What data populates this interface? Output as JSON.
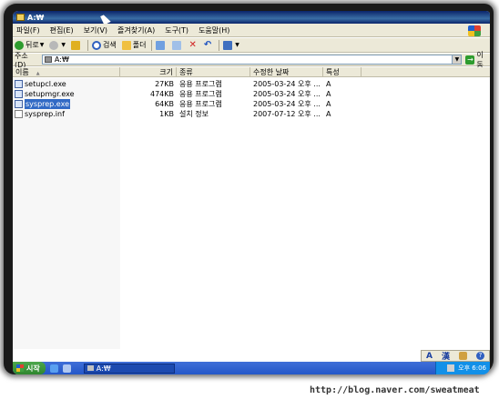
{
  "window": {
    "title": "A:₩"
  },
  "menu": {
    "items": [
      "파일(F)",
      "편집(E)",
      "보기(V)",
      "즐겨찾기(A)",
      "도구(T)",
      "도움말(H)"
    ]
  },
  "toolbar": {
    "back_label": "뒤로",
    "search_label": "검색",
    "folders_label": "폴더"
  },
  "address": {
    "label": "주소(D)",
    "value": "A:₩",
    "go_label": "이동"
  },
  "columns": {
    "name": "이름",
    "size": "크기",
    "type": "종류",
    "modified": "수정한 날짜",
    "attributes": "특성"
  },
  "files": [
    {
      "name": "setupcl.exe",
      "size": "27KB",
      "type": "응용 프로그램",
      "modified": "2005-03-24 오후 ...",
      "attr": "A",
      "selected": false
    },
    {
      "name": "setupmgr.exe",
      "size": "474KB",
      "type": "응용 프로그램",
      "modified": "2005-03-24 오후 ...",
      "attr": "A",
      "selected": false
    },
    {
      "name": "sysprep.exe",
      "size": "64KB",
      "type": "응용 프로그램",
      "modified": "2005-03-24 오후 ...",
      "attr": "A",
      "selected": true
    },
    {
      "name": "sysprep.inf",
      "size": "1KB",
      "type": "설치 정보",
      "modified": "2007-07-12 오후 ...",
      "attr": "A",
      "selected": false
    }
  ],
  "langbar": {
    "mode": "A",
    "hanja": "漢"
  },
  "taskbar": {
    "start_label": "시작",
    "window_button": "A:₩",
    "clock": "오후 6:06"
  },
  "watermark": "http://blog.naver.com/sweatmeat",
  "colors": {
    "titlebar": "#0a246a",
    "selection": "#316ac5",
    "taskbar": "#2457c8",
    "start": "#2e862e"
  }
}
